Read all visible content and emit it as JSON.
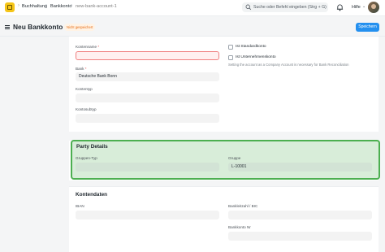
{
  "navbar": {
    "breadcrumbs": [
      "Buchhaltung",
      "Bankkonto",
      "new-bank-account-1"
    ],
    "search_placeholder": "Suche oder Befehl eingeben (Strg + G)",
    "help_label": "Hilfe"
  },
  "header": {
    "title": "Neu Bankkonto",
    "status": "Nicht gespeichert",
    "save_label": "Speichern"
  },
  "account_section": {
    "kontenname": {
      "label": "Kontenname",
      "value": ""
    },
    "bank": {
      "label": "Bank",
      "value": "Deutsche Bank Bonn"
    },
    "kontentyp": {
      "label": "Kontentyp",
      "value": ""
    },
    "kontosubtyp": {
      "label": "Kontosubtyp",
      "value": ""
    },
    "is_default": {
      "label": "Ist Standardkonto",
      "checked": false
    },
    "is_company": {
      "label": "Ist Unternehmenskonto",
      "checked": false
    },
    "company_hint": "Setting the account as a Company Account is necessary for Bank Reconciliation"
  },
  "party_section": {
    "title": "Party Details",
    "gruppen_typ": {
      "label": "Gruppen-Typ",
      "value": ""
    },
    "gruppe": {
      "label": "Gruppe",
      "value": "L-10001"
    }
  },
  "kontodaten_section": {
    "title": "Kontendaten",
    "iban": {
      "label": "IBAN",
      "value": ""
    },
    "bankleitzahl": {
      "label": "Bankleitzahl / BIC",
      "value": ""
    },
    "bankkonto_nr": {
      "label": "Bankkonto Nr",
      "value": ""
    }
  },
  "colors": {
    "primary": "#2490ef",
    "highlight": "#4caf50",
    "status_warning": "#e86c13",
    "logo": "#f5c518"
  }
}
